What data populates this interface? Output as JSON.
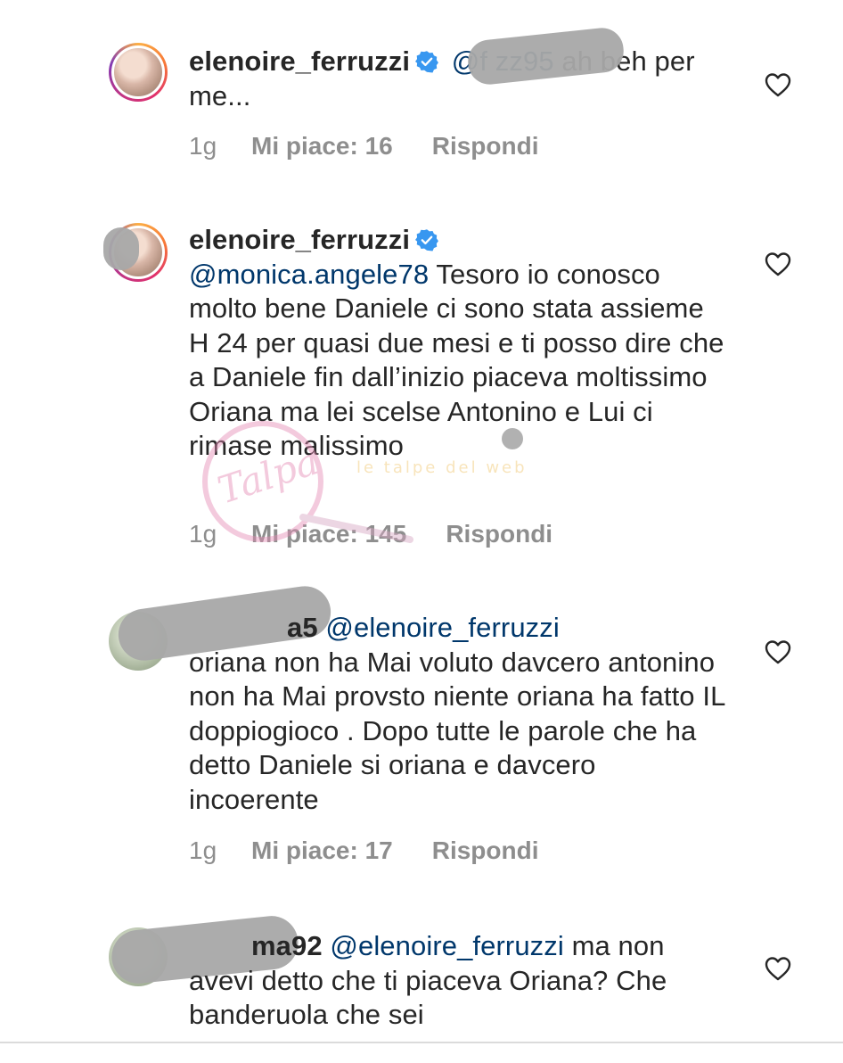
{
  "comments": [
    {
      "username": "elenoire_ferruzzi",
      "mention": "@f        zz95",
      "text": " ah beh per me...",
      "time": "1g",
      "likes": "Mi piace: 16",
      "reply": "Rispondi"
    },
    {
      "username": "elenoire_ferruzzi",
      "mention": "@monica.angele78",
      "text": " Tesoro io conosco molto bene Daniele ci sono stata assieme H 24 per quasi due mesi e ti posso dire che a Daniele fin dall’inizio piaceva moltissimo Oriana  ma lei scelse Antonino e Lui ci  rimase malissimo",
      "time": "1g",
      "likes": "Mi piace: 145",
      "reply": "Rispondi"
    },
    {
      "username": "a5",
      "mention": "@elenoire_ferruzzi",
      "text": "oriana non ha Mai voluto davcero antonino non ha Mai provsto niente oriana ha fatto IL doppiogioco . Dopo tutte le parole che ha detto Daniele si oriana e davcero incoerente",
      "time": "1g",
      "likes": "Mi piace: 17",
      "reply": "Rispondi"
    },
    {
      "username": "ma92",
      "mention": "@elenoire_ferruzzi",
      "text": " ma non avevi detto che ti piaceva Oriana? Che banderuola che sei"
    }
  ],
  "watermark_text": "le talpe del web",
  "colors": {
    "text": "#262626",
    "mention": "#00376b",
    "meta": "#8e8e8e",
    "verified": "#3897f0"
  },
  "icons": [
    "verified-badge-icon",
    "heart-icon"
  ]
}
